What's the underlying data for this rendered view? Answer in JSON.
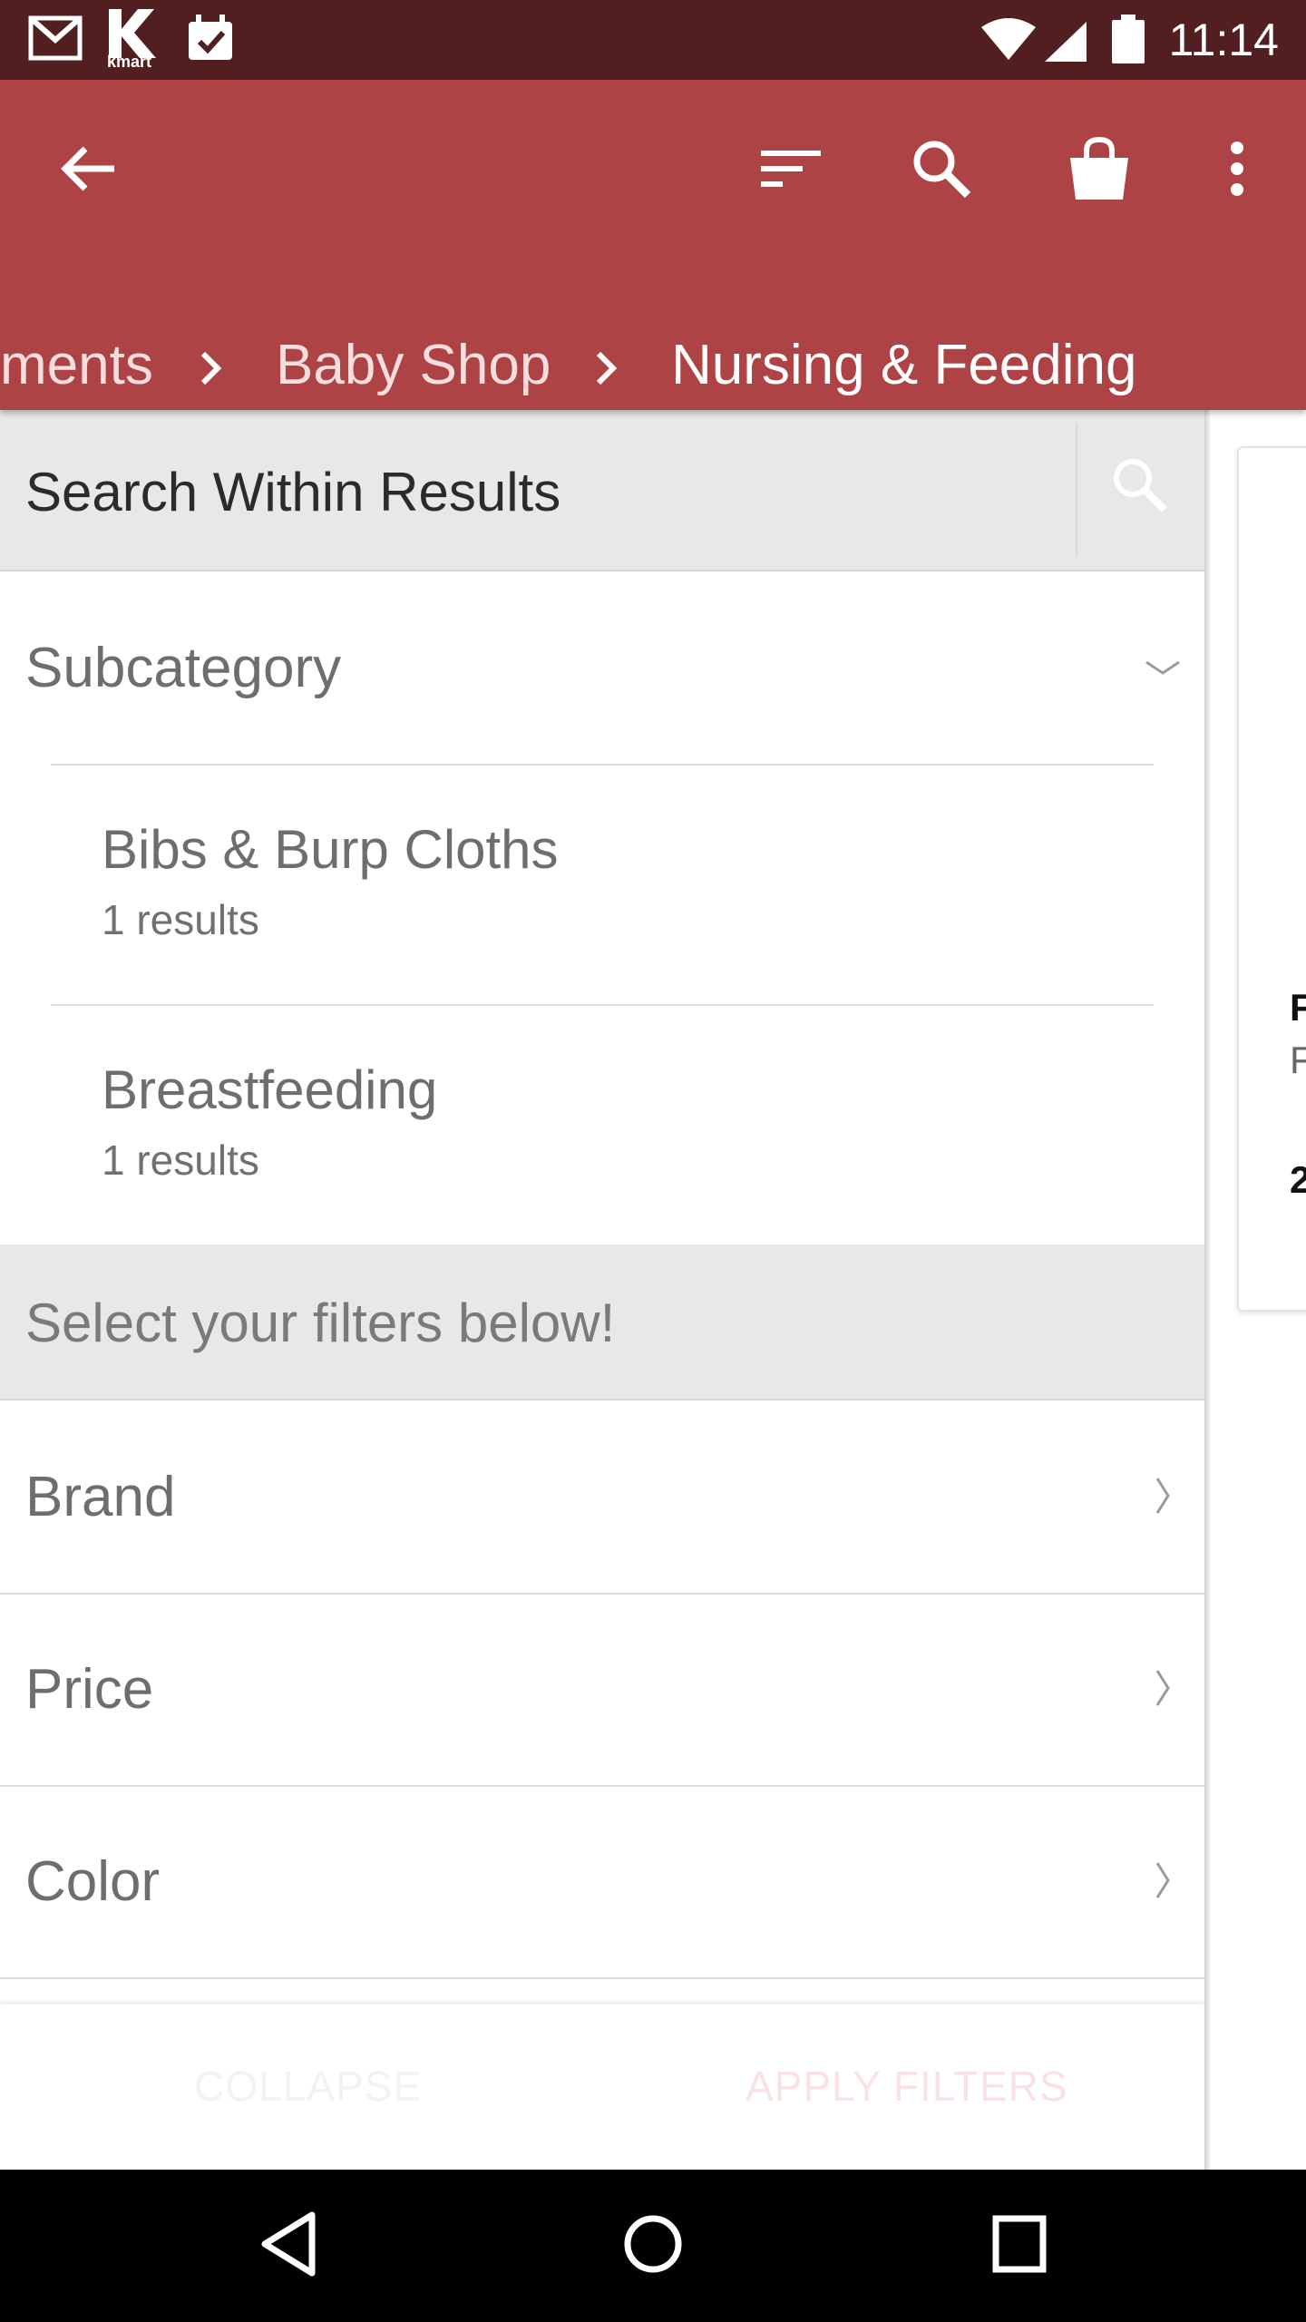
{
  "status_bar": {
    "time": "11:14",
    "left_icons": [
      "gmail-icon",
      "kmart-icon",
      "calendar-check-icon"
    ],
    "kmart_badge": "kmart",
    "right_icons": [
      "wifi-icon",
      "cell-signal-icon",
      "battery-icon"
    ]
  },
  "app_bar": {
    "color": "#ad4344",
    "actions": [
      "back-arrow-icon",
      "sort-icon",
      "search-icon",
      "shopping-bag-icon",
      "more-vert-icon"
    ],
    "breadcrumb": [
      "ments",
      "Baby Shop",
      "Nursing & Feeding"
    ]
  },
  "panel": {
    "search_label": "Search Within Results",
    "section_title": "Subcategory",
    "subcategories": [
      {
        "name": "Bibs & Burp Cloths",
        "count": "1 results"
      },
      {
        "name": "Breastfeeding",
        "count": "1 results"
      }
    ],
    "filters_banner": "Select your filters below!",
    "filters": [
      "Brand",
      "Price",
      "Color"
    ],
    "footer": {
      "collapse": "COLLAPSE",
      "apply": "APPLY FILTERS"
    }
  },
  "peek": {
    "line1": "F",
    "line2": "F",
    "line3": "2"
  },
  "colors": {
    "status_bar": "#521f20",
    "panel_bg": "#e8e8e8",
    "accent": "#ad4344"
  }
}
